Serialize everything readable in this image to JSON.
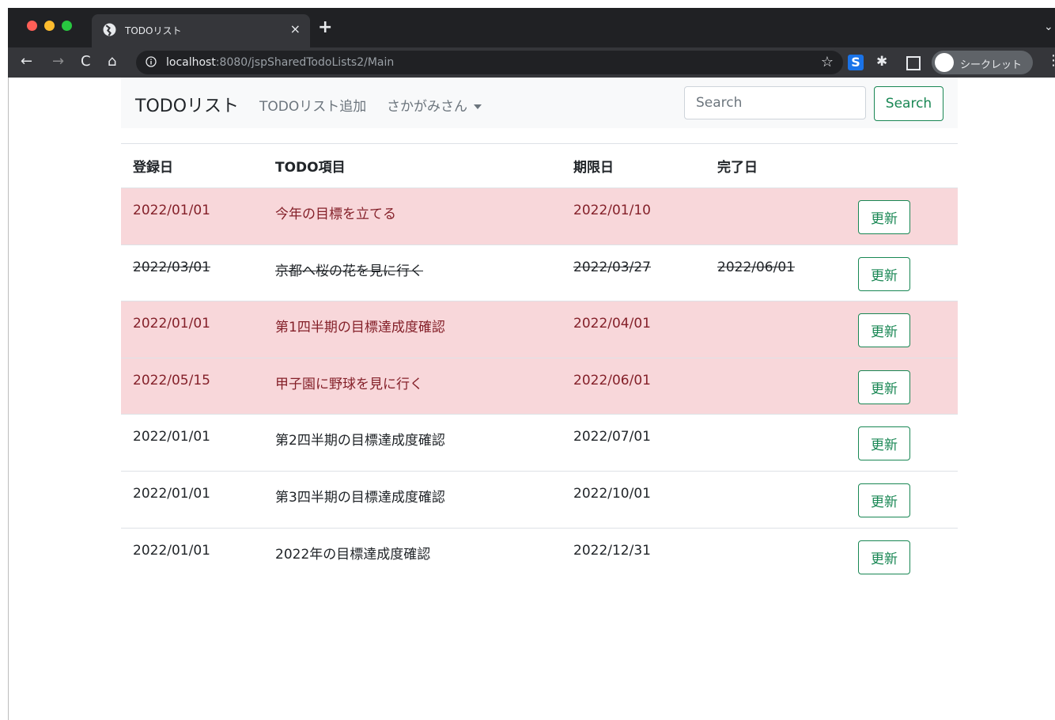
{
  "browser": {
    "tab_title": "TODOリスト",
    "new_tab": "+",
    "close": "×",
    "url_host": "localhost",
    "url_rest": ":8080/jspSharedTodoLists2/Main",
    "incognito_label": "シークレット",
    "star": "☆",
    "ext_s": "S",
    "back": "←",
    "forward": "→",
    "reload": "C",
    "home": "⌂",
    "menu": "⋮",
    "tab_menu": "⌄",
    "puzzle": "✱"
  },
  "navbar": {
    "brand": "TODOリスト",
    "add_link": "TODOリスト追加",
    "user": "さかがみさん",
    "search_placeholder": "Search",
    "search_button": "Search"
  },
  "table": {
    "headers": [
      "登録日",
      "TODO項目",
      "期限日",
      "完了日",
      ""
    ],
    "update_label": "更新",
    "rows": [
      {
        "registered": "2022/01/01",
        "item": "今年の目標を立てる",
        "due": "2022/01/10",
        "done": "",
        "status": "overdue"
      },
      {
        "registered": "2022/03/01",
        "item": "京都へ桜の花を見に行く",
        "due": "2022/03/27",
        "done": "2022/06/01",
        "status": "done"
      },
      {
        "registered": "2022/01/01",
        "item": "第1四半期の目標達成度確認",
        "due": "2022/04/01",
        "done": "",
        "status": "overdue"
      },
      {
        "registered": "2022/05/15",
        "item": "甲子園に野球を見に行く",
        "due": "2022/06/01",
        "done": "",
        "status": "overdue"
      },
      {
        "registered": "2022/01/01",
        "item": "第2四半期の目標達成度確認",
        "due": "2022/07/01",
        "done": "",
        "status": "normal"
      },
      {
        "registered": "2022/01/01",
        "item": "第3四半期の目標達成度確認",
        "due": "2022/10/01",
        "done": "",
        "status": "normal"
      },
      {
        "registered": "2022/01/01",
        "item": "2022年の目標達成度確認",
        "due": "2022/12/31",
        "done": "",
        "status": "normal"
      }
    ]
  },
  "colors": {
    "overdue_bg": "#f8d7da",
    "overdue_text": "#842029",
    "accent_green": "#198754"
  }
}
